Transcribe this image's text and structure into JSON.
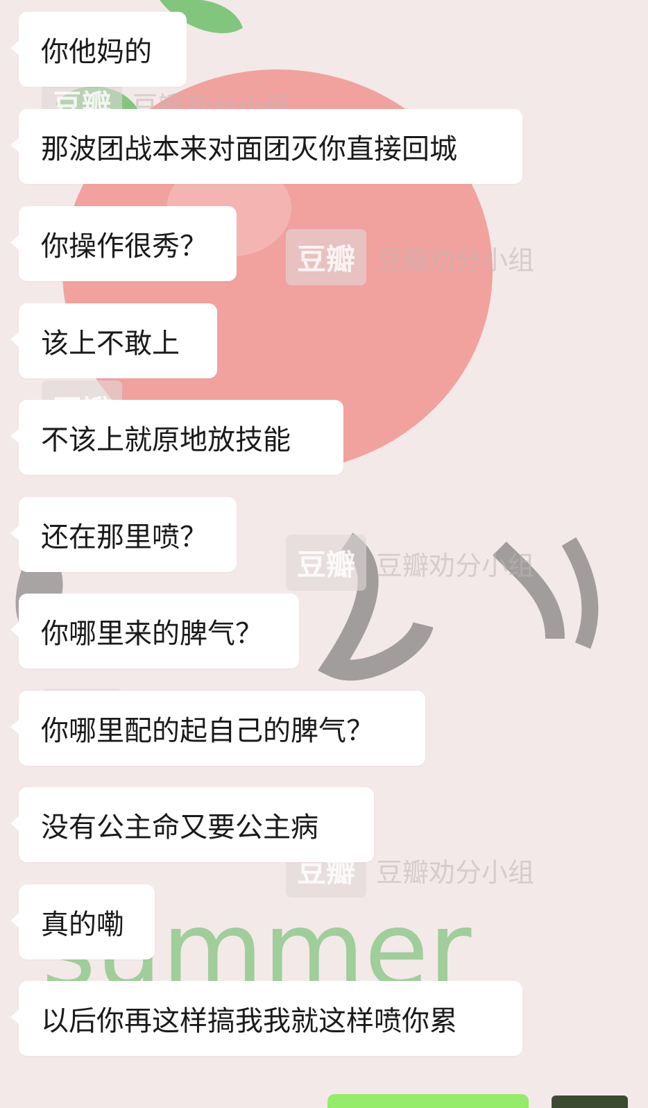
{
  "watermark": {
    "logo": "豆瓣",
    "text": "豆瓣劝分小组"
  },
  "background_decor": {
    "apple_color": "#f08a86",
    "leaf_color": "#6cbf68",
    "script_text": "summer"
  },
  "messages": [
    {
      "text": "你他妈的"
    },
    {
      "text": "那波团战本来对面团灭你直接回城"
    },
    {
      "text": "你操作很秀？"
    },
    {
      "text": "该上不敢上"
    },
    {
      "text": "不该上就原地放技能"
    },
    {
      "text": "还在那里喷？"
    },
    {
      "text": "你哪里来的脾气？"
    },
    {
      "text": "你哪里配的起自己的脾气？"
    },
    {
      "text": "没有公主命又要公主病"
    },
    {
      "text": "真的嘞"
    },
    {
      "text": "以后你再这样搞我我就这样喷你累"
    }
  ],
  "colors": {
    "incoming_bubble": "#ffffff",
    "outgoing_bubble": "#95ec69"
  }
}
